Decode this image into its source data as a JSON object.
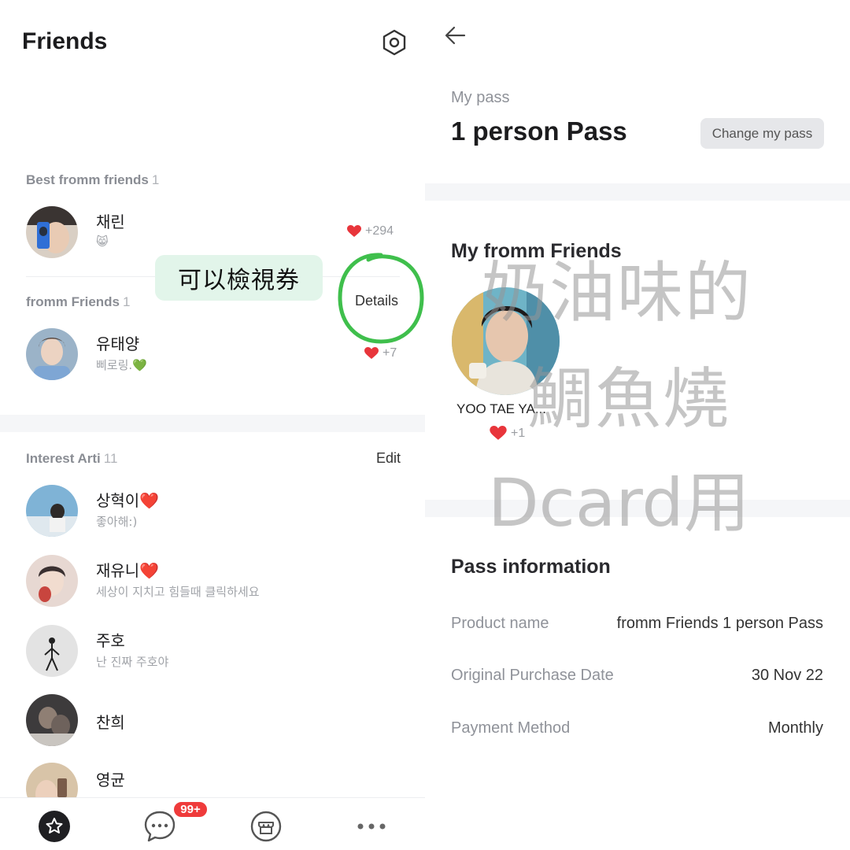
{
  "left": {
    "title": "Friends",
    "best_section": {
      "label": "Best fromm friends",
      "count": "1"
    },
    "best_friend": {
      "name": "채린",
      "status": "😸",
      "likes": "+294"
    },
    "friends_section": {
      "label": "fromm Friends",
      "count": "1"
    },
    "friend": {
      "name": "유태양",
      "status": "삐로링.💚",
      "likes": "+7"
    },
    "annotation_bubble": "可以檢視券",
    "details_label": "Details",
    "interest_section": {
      "label": "Interest Arti",
      "count": "11",
      "edit_label": "Edit"
    },
    "interest_items": [
      {
        "name": "상혁이❤️",
        "status": "좋아해:)"
      },
      {
        "name": "재유니❤️",
        "status": "세상이 지치고 힘들때 클릭하세요"
      },
      {
        "name": "주호",
        "status": "난 진짜 주호야"
      },
      {
        "name": "찬희",
        "status": ""
      },
      {
        "name": "영균",
        "status": ""
      }
    ],
    "tabbar": {
      "tabs": [
        "star-icon",
        "chat-bubble-icon",
        "store-icon",
        "more-icon"
      ],
      "badge": "99+"
    }
  },
  "right": {
    "my_pass_label": "My pass",
    "pass_name": "1 person Pass",
    "change_button": "Change my pass",
    "friends_title": "My fromm Friends",
    "favorite": {
      "name": "YOO TAE YA...",
      "likes": "+1"
    },
    "info_title": "Pass information",
    "info_rows": [
      {
        "key": "Product name",
        "value": "fromm Friends 1 person Pass"
      },
      {
        "key": "Original Purchase Date",
        "value": "30 Nov 22"
      },
      {
        "key": "Payment Method",
        "value": "Monthly"
      }
    ]
  },
  "watermark": {
    "line1": "奶油味的",
    "line2": "鯛魚燒",
    "line3": "Dcard用"
  },
  "colors": {
    "heart": "#e8353b",
    "annotation_green": "#3fbf4c",
    "badge": "#ef3b3b",
    "bubble_bg": "#e2f5ea"
  }
}
